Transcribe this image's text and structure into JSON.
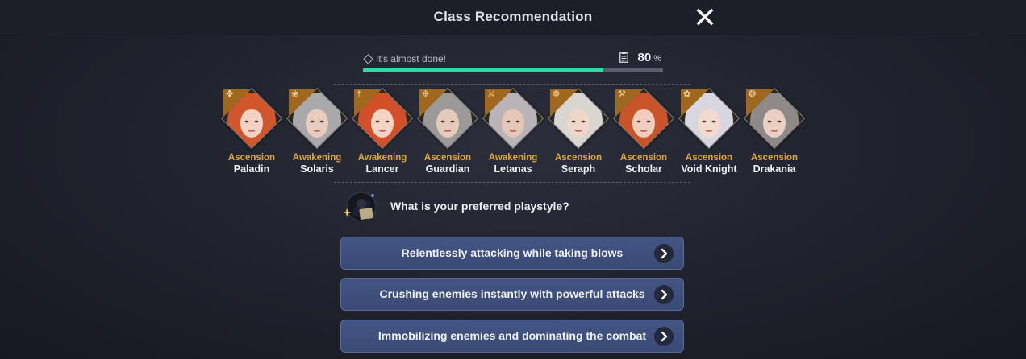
{
  "header": {
    "title": "Class Recommendation",
    "close_icon": "close-icon"
  },
  "progress": {
    "hint": "It's almost done!",
    "percent_value": "80",
    "percent_symbol": "%",
    "fraction": 0.8
  },
  "classes": [
    {
      "type": "Ascension",
      "name": "Paladin",
      "hair": "#d2562c",
      "skin": "#f1d2c3"
    },
    {
      "type": "Awakening",
      "name": "Solaris",
      "hair": "#a9a8ab",
      "skin": "#e8cdbf"
    },
    {
      "type": "Awakening",
      "name": "Lancer",
      "hair": "#d34f29",
      "skin": "#f3d3c4"
    },
    {
      "type": "Ascension",
      "name": "Guardian",
      "hair": "#9c9a98",
      "skin": "#e5cab9"
    },
    {
      "type": "Awakening",
      "name": "Letanas",
      "hair": "#b9b4b8",
      "skin": "#e6c6b6"
    },
    {
      "type": "Ascension",
      "name": "Seraph",
      "hair": "#d9d6d2",
      "skin": "#f0d6c9"
    },
    {
      "type": "Ascension",
      "name": "Scholar",
      "hair": "#c9542a",
      "skin": "#f0cdbd"
    },
    {
      "type": "Ascension",
      "name": "Void Knight",
      "hair": "#d8d6e0",
      "skin": "#f1dbcf"
    },
    {
      "type": "Ascension",
      "name": "Drakania",
      "hair": "#8f8a88",
      "skin": "#ead0c2"
    }
  ],
  "question": {
    "text": "What is your preferred playstyle?"
  },
  "options": [
    {
      "label": "Relentlessly attacking while taking blows"
    },
    {
      "label": "Crushing enemies instantly with powerful attacks"
    },
    {
      "label": "Immobilizing enemies and dominating the combat"
    }
  ],
  "colors": {
    "accent": "#34d8a4",
    "button": "#3f5080",
    "class_type": "#e0a83a"
  }
}
